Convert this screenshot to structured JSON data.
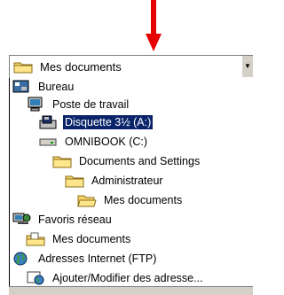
{
  "combo": {
    "selected_label": "Mes documents",
    "icon": "folder-icon"
  },
  "items": [
    {
      "label": "Bureau",
      "icon": "desktop-icon"
    },
    {
      "label": "Poste de travail",
      "icon": "computer-icon"
    },
    {
      "label": "Disquette 3½ (A:)",
      "icon": "floppy-drive-icon",
      "selected": true
    },
    {
      "label": "OMNIBOOK (C:)",
      "icon": "hard-drive-icon"
    },
    {
      "label": "Documents and Settings",
      "icon": "folder-icon"
    },
    {
      "label": "Administrateur",
      "icon": "folder-icon"
    },
    {
      "label": "Mes documents",
      "icon": "open-folder-icon"
    },
    {
      "label": "Favoris réseau",
      "icon": "network-icon"
    },
    {
      "label": "Mes documents",
      "icon": "documents-folder-icon"
    },
    {
      "label": "Adresses Internet (FTP)",
      "icon": "globe-icon"
    },
    {
      "label": "Ajouter/Modifier des adresse...",
      "icon": "ftp-icon"
    }
  ],
  "colors": {
    "selection": "#0a246a",
    "arrow": "#e60000",
    "chrome": "#d4d0c8"
  }
}
